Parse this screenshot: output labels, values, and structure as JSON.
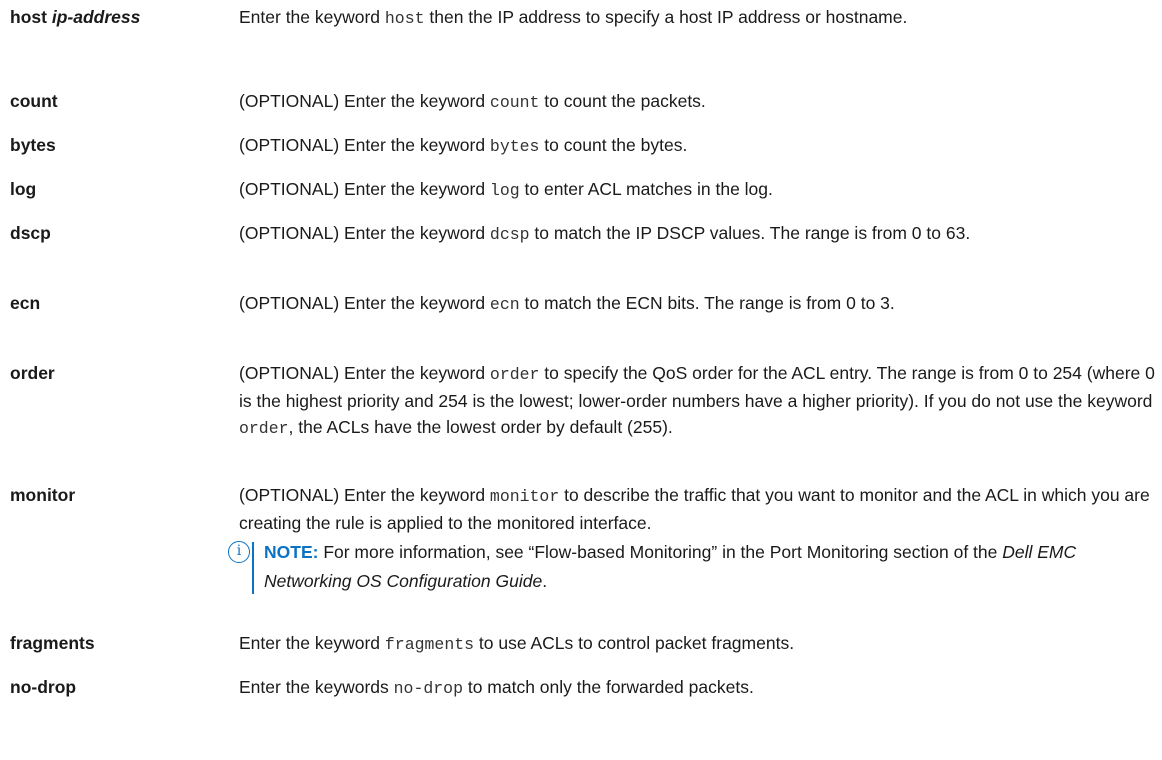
{
  "params": [
    {
      "term": "host",
      "term_arg": "ip-address",
      "parts": [
        "Enter the keyword ",
        "host",
        " then the IP address to specify a host IP address or hostname."
      ]
    },
    {
      "term": "count",
      "parts": [
        "(OPTIONAL) Enter the keyword ",
        "count",
        " to count the packets."
      ]
    },
    {
      "term": "bytes",
      "parts": [
        "(OPTIONAL) Enter the keyword ",
        "bytes",
        " to count the bytes."
      ]
    },
    {
      "term": "log",
      "parts": [
        "(OPTIONAL) Enter the keyword ",
        "log",
        " to enter ACL matches in the log."
      ]
    },
    {
      "term": "dscp",
      "parts": [
        "(OPTIONAL) Enter the keyword ",
        "dcsp",
        " to match the IP DSCP values. The range is from 0 to 63."
      ]
    },
    {
      "term": "ecn",
      "parts": [
        "(OPTIONAL) Enter the keyword ",
        "ecn",
        " to match the ECN bits. The range is from 0 to 3."
      ]
    },
    {
      "term": "order",
      "parts": [
        "(OPTIONAL) Enter the keyword ",
        "order",
        " to specify the QoS order for the ACL entry. The range is from 0 to 254 (where 0 is the highest priority and 254 is the lowest; lower-order numbers have a higher priority). If you do not use the keyword ",
        "order",
        ", the ACLs have the lowest order by default (255)."
      ]
    },
    {
      "term": "monitor",
      "parts": [
        "(OPTIONAL) Enter the keyword ",
        "monitor",
        " to describe the traffic that you want to monitor and the ACL in which you are creating the rule is applied to the monitored interface."
      ],
      "note": {
        "icon": "info-icon",
        "icon_glyph": "i",
        "label": "NOTE:",
        "text_before": " For more information, see “Flow-based Monitoring” in the Port Monitoring section of the ",
        "text_italic": "Dell EMC Networking OS Configuration Guide",
        "text_after": "."
      }
    },
    {
      "term": "fragments",
      "parts": [
        "Enter the keyword ",
        "fragments",
        " to use ACLs to control packet fragments."
      ]
    },
    {
      "term": "no-drop",
      "parts": [
        "Enter the keywords ",
        "no-drop",
        " to match only the forwarded packets."
      ]
    }
  ],
  "colors": {
    "note_accent": "#0b72c4",
    "text": "#1a1a1a"
  }
}
